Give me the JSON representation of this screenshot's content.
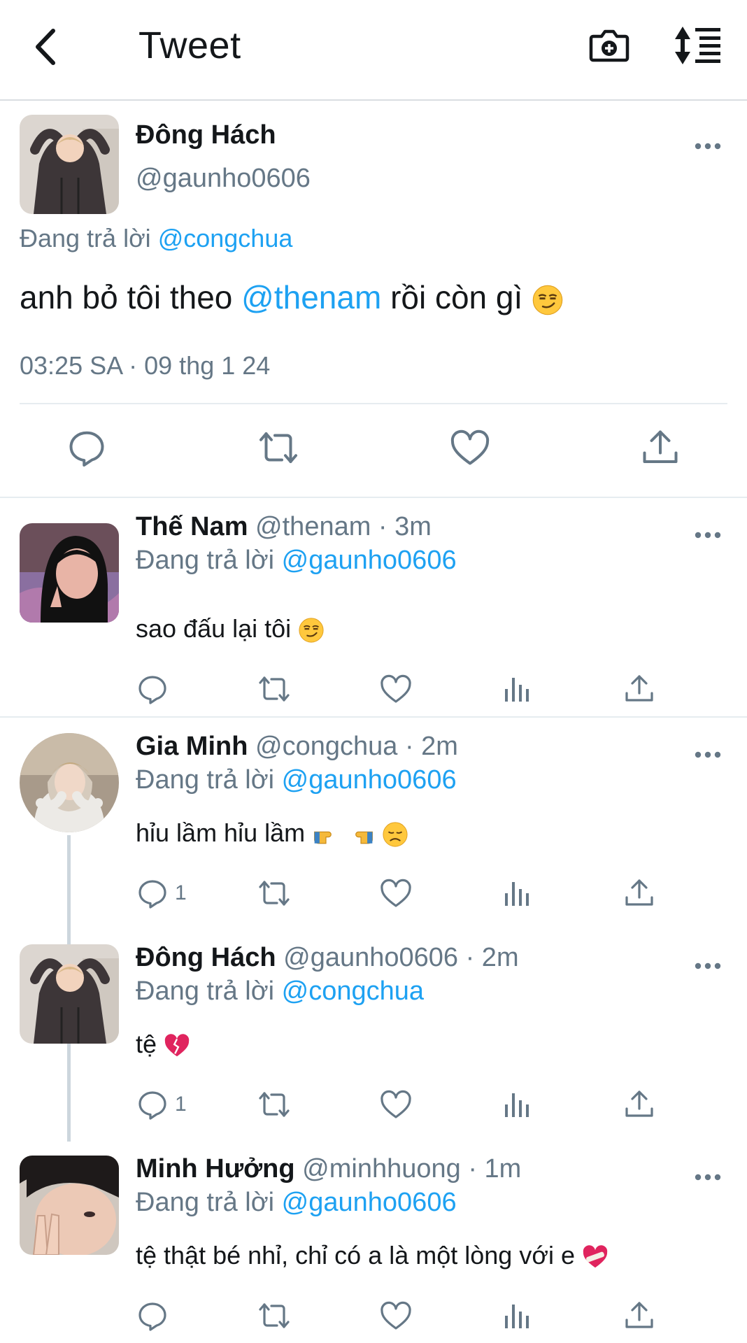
{
  "header": {
    "title": "Tweet"
  },
  "main_tweet": {
    "name": "Đông Hách",
    "handle": "@gaunho0606",
    "replying_prefix": "Đang trả lời ",
    "replying_to": "@congchua",
    "text_before": "anh bỏ tôi theo ",
    "text_mention": "@thenam",
    "text_after": " rồi còn gì",
    "timestamp": "03:25 SA · 09 thg 1 24"
  },
  "replies": [
    {
      "name": "Thế Nam",
      "meta": "@thenam · 3m",
      "replying_prefix": "Đang trả lời ",
      "replying_to": "@gaunho0606",
      "text": "sao đấu lại tôi",
      "reply_count": ""
    },
    {
      "name": "Gia Minh",
      "meta": "@congchua · 2m",
      "replying_prefix": "Đang trả lời ",
      "replying_to": "@gaunho0606",
      "text": "hỉu lầm hỉu lầm",
      "reply_count": "1"
    },
    {
      "name": "Đông Hách",
      "meta": "@gaunho0606 · 2m",
      "replying_prefix": "Đang trả lời ",
      "replying_to": "@congchua",
      "text": "tệ",
      "reply_count": "1"
    },
    {
      "name": "Minh Hưởng",
      "meta": "@minhhuong · 1m",
      "replying_prefix": "Đang trả lời ",
      "replying_to": "@gaunho0606",
      "text": "tệ thật bé nhỉ, chỉ có a là một lòng với e",
      "reply_count": ""
    }
  ],
  "colors": {
    "link": "#1da1f2",
    "secondary_text": "#657786",
    "divider": "#e6ecf0",
    "thread_line": "#ccd6dd"
  },
  "icons": [
    "back-arrow-icon",
    "camera-icon",
    "sort-icon",
    "more-icon",
    "reply-icon",
    "retweet-icon",
    "like-icon",
    "share-icon",
    "analytics-icon",
    "smirk-emoji",
    "pointing-emoji",
    "sad-emoji",
    "broken-heart-emoji",
    "mending-heart-emoji"
  ]
}
